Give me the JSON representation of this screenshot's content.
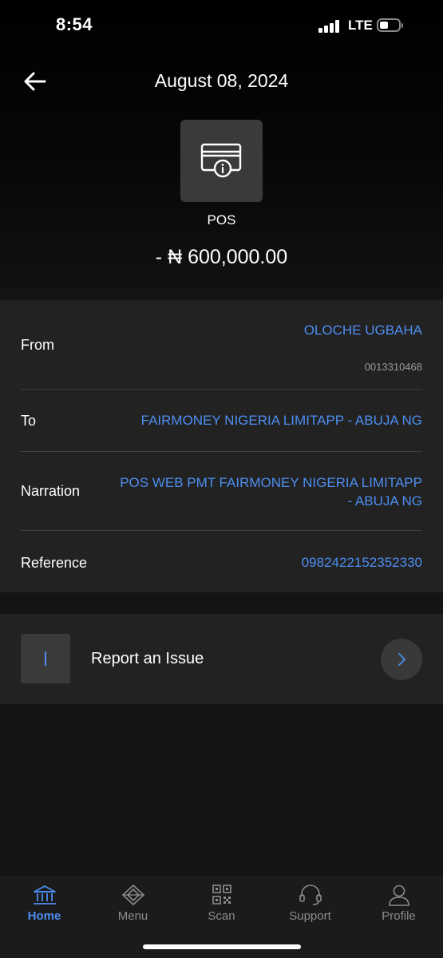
{
  "status_bar": {
    "time": "8:54",
    "network": "LTE"
  },
  "header": {
    "title": "August 08, 2024"
  },
  "transaction": {
    "type_label": "POS",
    "amount": "- ₦ 600,000.00"
  },
  "details": {
    "from": {
      "label": "From",
      "name": "OLOCHE UGBAHA",
      "account": "0013310468"
    },
    "to": {
      "label": "To",
      "value": "FAIRMONEY NIGERIA LIMITAPP - ABUJA NG"
    },
    "narration": {
      "label": "Narration",
      "line1": "POS WEB PMT FAIRMONEY NIGERIA LIMITAPP",
      "line2": "- ABUJA NG"
    },
    "reference": {
      "label": "Reference",
      "value": "0982422152352330"
    }
  },
  "report": {
    "label": "Report an Issue"
  },
  "bottom_nav": {
    "items": [
      {
        "label": "Home",
        "icon": "bank-icon",
        "active": true
      },
      {
        "label": "Menu",
        "icon": "diamond-icon",
        "active": false
      },
      {
        "label": "Scan",
        "icon": "qr-code-icon",
        "active": false
      },
      {
        "label": "Support",
        "icon": "headset-icon",
        "active": false
      },
      {
        "label": "Profile",
        "icon": "user-icon",
        "active": false
      }
    ]
  },
  "colors": {
    "accent": "#4d8ef0",
    "card": "#222222",
    "background": "#141414"
  }
}
